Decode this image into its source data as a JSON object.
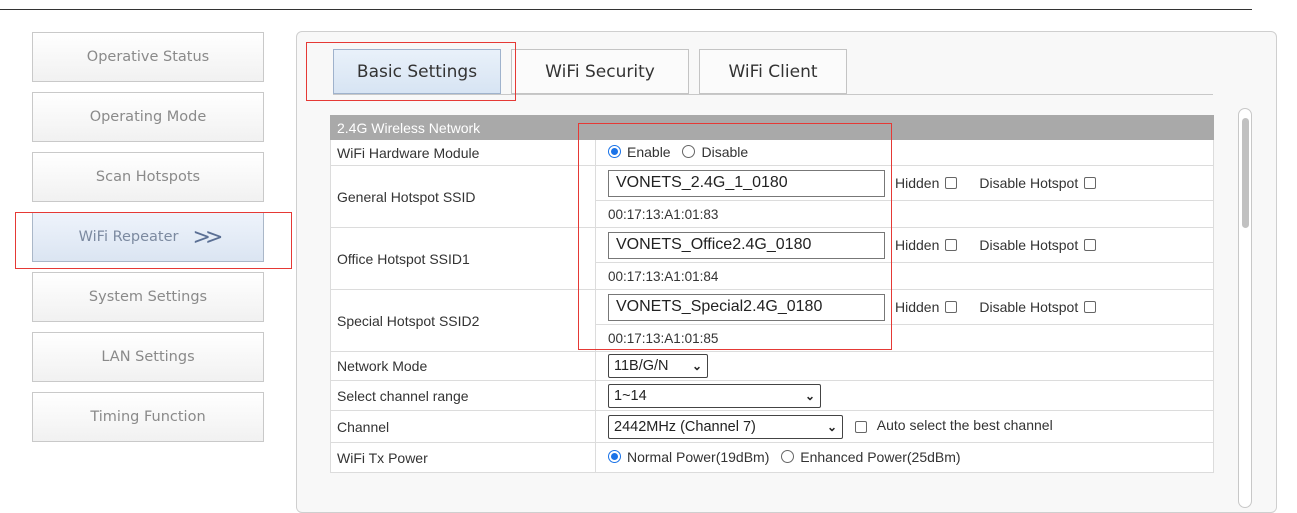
{
  "sidebar": {
    "items": [
      {
        "label": "Operative Status"
      },
      {
        "label": "Operating Mode"
      },
      {
        "label": "Scan Hotspots"
      },
      {
        "label": "WiFi Repeater",
        "arrow": ">>"
      },
      {
        "label": "System Settings"
      },
      {
        "label": "LAN Settings"
      },
      {
        "label": "Timing Function"
      }
    ]
  },
  "tabs": {
    "basic": "Basic Settings",
    "security": "WiFi Security",
    "client": "WiFi Client"
  },
  "section": {
    "title": "2.4G Wireless Network"
  },
  "hardware": {
    "label": "WiFi Hardware Module",
    "enable": "Enable",
    "disable": "Disable",
    "selected": "Enable"
  },
  "ssids": [
    {
      "label": "General Hotspot SSID",
      "value": "VONETS_2.4G_1_0180",
      "mac": "00:17:13:A1:01:83",
      "hidden_label": "Hidden",
      "disable_label": "Disable Hotspot"
    },
    {
      "label": "Office Hotspot SSID1",
      "value": "VONETS_Office2.4G_0180",
      "mac": "00:17:13:A1:01:84",
      "hidden_label": "Hidden",
      "disable_label": "Disable Hotspot"
    },
    {
      "label": "Special Hotspot SSID2",
      "value": "VONETS_Special2.4G_0180",
      "mac": "00:17:13:A1:01:85",
      "hidden_label": "Hidden",
      "disable_label": "Disable Hotspot"
    }
  ],
  "network_mode": {
    "label": "Network Mode",
    "value": "11B/G/N"
  },
  "channel_range": {
    "label": "Select channel range",
    "value": "1~14"
  },
  "channel": {
    "label": "Channel",
    "value": "2442MHz (Channel 7)",
    "auto_label": "Auto select the best channel"
  },
  "tx_power": {
    "label": "WiFi Tx Power",
    "normal": "Normal Power(19dBm)",
    "enhanced": "Enhanced Power(25dBm)",
    "selected": "Normal Power(19dBm)"
  },
  "colors": {
    "highlight": "#e53935",
    "section_header": "#a9a9a9",
    "radio_selected": "#1a73e8"
  }
}
